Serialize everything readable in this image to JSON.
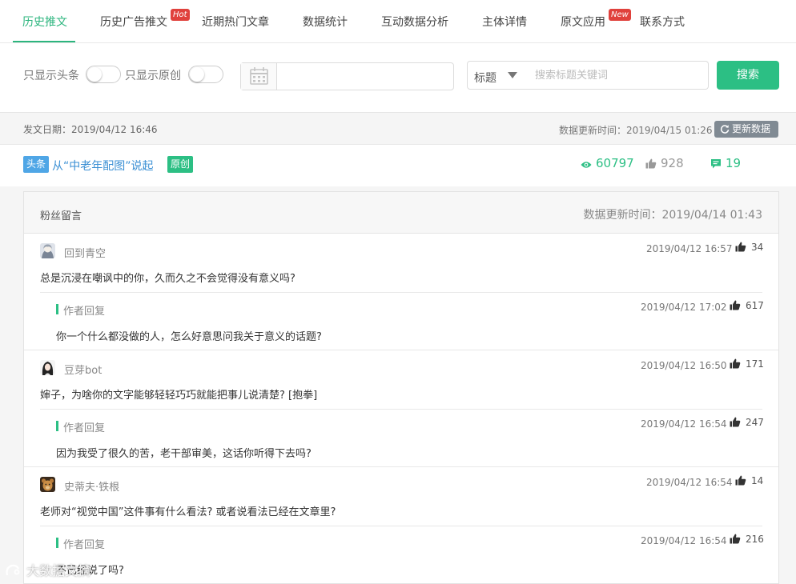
{
  "tabs": [
    {
      "label": "历史推文"
    },
    {
      "label": "历史广告推文",
      "badge": "Hot"
    },
    {
      "label": "近期热门文章"
    },
    {
      "label": "数据统计"
    },
    {
      "label": "互动数据分析"
    },
    {
      "label": "主体详情"
    },
    {
      "label": "原文应用",
      "badge": "New"
    },
    {
      "label": "联系方式"
    }
  ],
  "filters": {
    "toggle_headline_label": "只显示头条",
    "toggle_original_label": "只显示原创",
    "date_value": "",
    "select_value": "标题",
    "search_placeholder": "搜索标题关键词",
    "search_button": "搜索"
  },
  "meta": {
    "publish": "发文日期：2019/04/12 16:46",
    "updated": "数据更新时间：2019/04/15 01:26",
    "refresh_button": "更新数据"
  },
  "article": {
    "tag_headline": "头条",
    "title": "从“中老年配图”说起",
    "tag_original": "原创",
    "views": "60797",
    "likes": "928",
    "comments": "19"
  },
  "comments_panel": {
    "title": "粉丝留言",
    "updated": "数据更新时间：2019/04/14 01:43",
    "items": [
      {
        "user": "回到青空",
        "avatar_icon": "anime-avatar",
        "time": "2019/04/12 16:57",
        "likes": "34",
        "text": "总是沉浸在嘲讽中的你，久而久之不会觉得没有意义吗?",
        "reply": {
          "label": "作者回复",
          "time": "2019/04/12 17:02",
          "likes": "617",
          "text": "你一个什么都没做的人，怎么好意思问我关于意义的话题?"
        }
      },
      {
        "user": "豆芽bot",
        "avatar_icon": "girl-avatar",
        "time": "2019/04/12 16:50",
        "likes": "171",
        "text": "婶子，为啥你的文字能够轻轻巧巧就能把事儿说清楚? [抱拳]",
        "reply": {
          "label": "作者回复",
          "time": "2019/04/12 16:54",
          "likes": "247",
          "text": "因为我受了很久的苦，老干部审美，这话你听得下去吗?"
        }
      },
      {
        "user": "史蒂夫·铁根",
        "avatar_icon": "bear-avatar",
        "time": "2019/04/12 16:54",
        "likes": "14",
        "text": "老师对“视觉中国”这件事有什么看法? 或者说看法已经在文章里?",
        "reply": {
          "label": "作者回复",
          "time": "2019/04/12 16:54",
          "likes": "216",
          "text": "不已经说了吗?"
        }
      }
    ]
  },
  "watermark": "大数据文摘",
  "colors": {
    "accent": "#2cbf84",
    "link": "#3a8fd4",
    "badge_red": "#e0413c",
    "tag_blue": "#4fa6e6"
  }
}
